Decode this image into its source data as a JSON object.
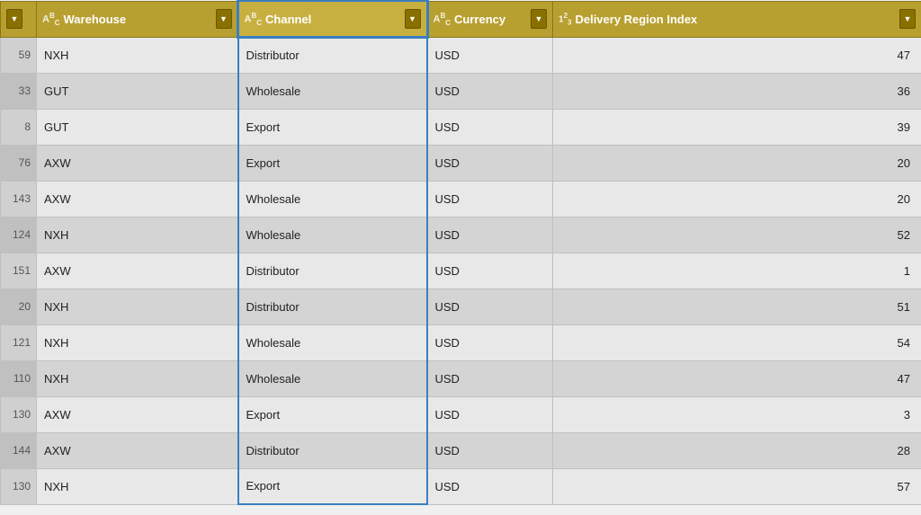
{
  "colors": {
    "header_bg": "#b8a030",
    "header_active_bg": "#c8b040",
    "active_border": "#3a7fc1",
    "odd_row": "#e8e8e8",
    "even_row": "#d4d4d4"
  },
  "columns": [
    {
      "id": "index",
      "label": "",
      "icon": "sort-icon",
      "type": "index"
    },
    {
      "id": "warehouse",
      "label": "Warehouse",
      "icon": "abc-icon",
      "type": "text"
    },
    {
      "id": "channel",
      "label": "Channel",
      "icon": "abc-icon",
      "type": "text",
      "active": true
    },
    {
      "id": "currency",
      "label": "Currency",
      "icon": "abc-icon",
      "type": "text"
    },
    {
      "id": "delivery",
      "label": "Delivery Region Index",
      "icon": "num-icon",
      "type": "number"
    }
  ],
  "rows": [
    {
      "index": 59,
      "warehouse": "NXH",
      "channel": "Distributor",
      "currency": "USD",
      "delivery": 47
    },
    {
      "index": 33,
      "warehouse": "GUT",
      "channel": "Wholesale",
      "currency": "USD",
      "delivery": 36
    },
    {
      "index": 8,
      "warehouse": "GUT",
      "channel": "Export",
      "currency": "USD",
      "delivery": 39
    },
    {
      "index": 76,
      "warehouse": "AXW",
      "channel": "Export",
      "currency": "USD",
      "delivery": 20
    },
    {
      "index": 143,
      "warehouse": "AXW",
      "channel": "Wholesale",
      "currency": "USD",
      "delivery": 20
    },
    {
      "index": 124,
      "warehouse": "NXH",
      "channel": "Wholesale",
      "currency": "USD",
      "delivery": 52
    },
    {
      "index": 151,
      "warehouse": "AXW",
      "channel": "Distributor",
      "currency": "USD",
      "delivery": 1
    },
    {
      "index": 20,
      "warehouse": "NXH",
      "channel": "Distributor",
      "currency": "USD",
      "delivery": 51
    },
    {
      "index": 121,
      "warehouse": "NXH",
      "channel": "Wholesale",
      "currency": "USD",
      "delivery": 54
    },
    {
      "index": 110,
      "warehouse": "NXH",
      "channel": "Wholesale",
      "currency": "USD",
      "delivery": 47
    },
    {
      "index": 130,
      "warehouse": "AXW",
      "channel": "Export",
      "currency": "USD",
      "delivery": 3
    },
    {
      "index": 144,
      "warehouse": "AXW",
      "channel": "Distributor",
      "currency": "USD",
      "delivery": 28
    },
    {
      "index": 130,
      "warehouse": "NXH",
      "channel": "Export",
      "currency": "USD",
      "delivery": 57
    }
  ],
  "header": {
    "sort_icon": "▼",
    "abc_label": "ABC",
    "num_label": "123"
  }
}
